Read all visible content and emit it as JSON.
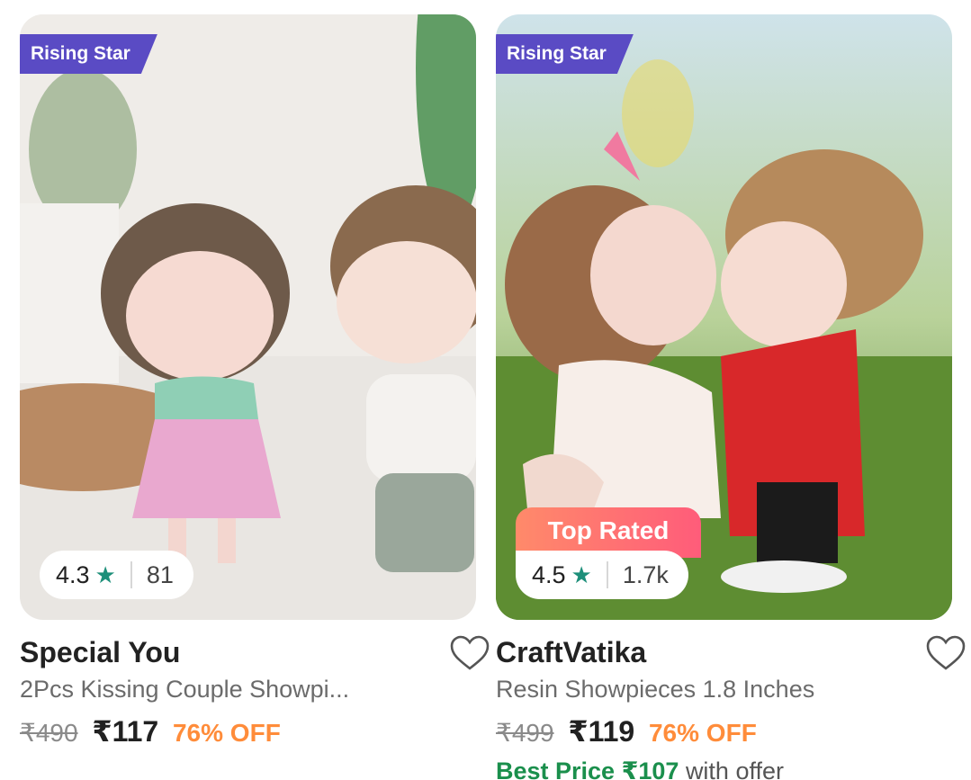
{
  "products": [
    {
      "badge": "Rising Star",
      "rating": "4.3",
      "rating_count": "81",
      "brand": "Special You",
      "description": "2Pcs Kissing Couple Showpi...",
      "mrp": "₹490",
      "price": "₹117",
      "discount": "76% OFF"
    },
    {
      "badge": "Rising Star",
      "top_badge": "Top Rated",
      "rating": "4.5",
      "rating_count": "1.7k",
      "brand": "CraftVatika",
      "description": "Resin Showpieces 1.8 Inches",
      "mrp": "₹499",
      "price": "₹119",
      "discount": "76% OFF",
      "best_price_label": "Best Price ₹107",
      "best_price_suffix": "with offer"
    }
  ],
  "icons": {
    "rating_star": "star-icon",
    "wishlist": "heart-icon"
  },
  "colors": {
    "badge_bg": "#5a4bc4",
    "star": "#1d8f7a",
    "discount": "#ff8c3a",
    "best_price": "#1a8f4c"
  }
}
